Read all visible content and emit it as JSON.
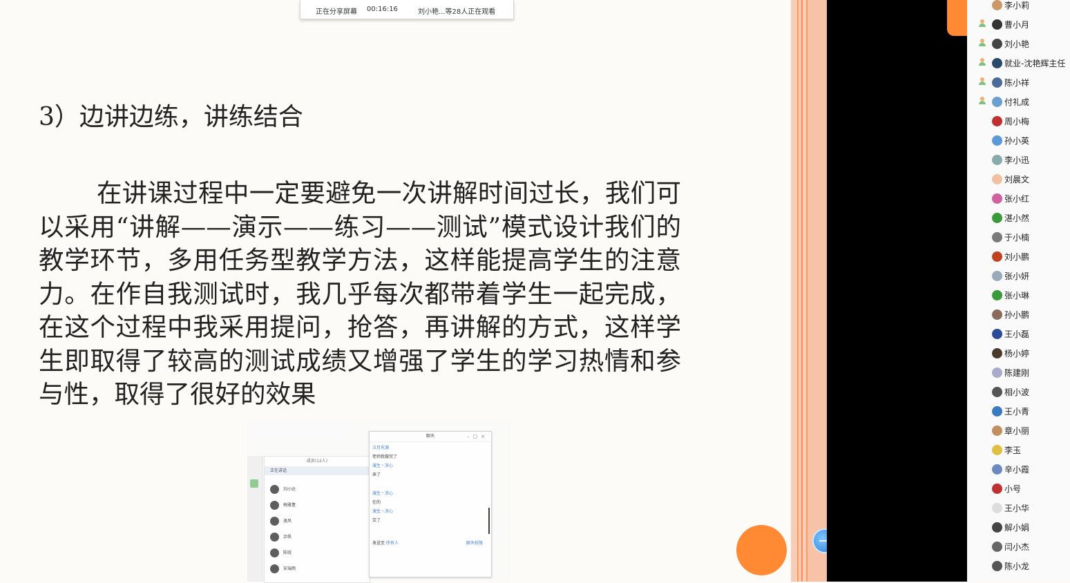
{
  "share_bar": {
    "status": "正在分享屏幕",
    "timer": "00:16:16",
    "viewers": "刘小艳...等28人正在观看"
  },
  "slide": {
    "heading": "3）边讲边练，讲练结合",
    "body": "在讲课过程中一定要避免一次讲解时间过长，我们可以采用“讲解——演示——练习——测试”模式设计我们的教学环节，多用任务型教学方法，这样能提高学生的注意力。在作自我测试时，我几乎每次都带着学生一起完成，在这个过程中我采用提问，抢答，再讲解的方式，这样学生即取得了较高的测试成绩又增强了学生的学习热情和参与性，取得了很好的效果"
  },
  "embedded": {
    "member_header": "成员(12人)",
    "member_filter": "正在讲话",
    "members": [
      "刘小达",
      "梅雅董",
      "逸风",
      "余帆",
      "陈晓",
      "安瑞雨"
    ],
    "chat_title": "聊天",
    "chat_lines": [
      {
        "type": "name",
        "text": "汪月东源"
      },
      {
        "type": "msg",
        "text": "老师我做完了"
      },
      {
        "type": "name",
        "text": "演生丶凉心"
      },
      {
        "type": "msg",
        "text": "来了"
      },
      {
        "type": "name",
        "text": "演生丶凉心"
      },
      {
        "type": "msg",
        "text": "在的"
      },
      {
        "type": "name",
        "text": "演生丶凉心"
      },
      {
        "type": "msg",
        "text": "交了"
      }
    ],
    "send_to_label": "发送至",
    "send_to_value": "所有人",
    "chat_permission": "聊天权限"
  },
  "attendees": [
    {
      "name": "李小莉",
      "host": false,
      "color": "#c96"
    },
    {
      "name": "曹小月",
      "host": true,
      "color": "#333"
    },
    {
      "name": "刘小艳",
      "host": true,
      "color": "#444"
    },
    {
      "name": "就业-沈艳辉主任",
      "host": true,
      "color": "#2a4a6a"
    },
    {
      "name": "陈小祥",
      "host": true,
      "color": "#4a6a9a"
    },
    {
      "name": "付礼成",
      "host": true,
      "color": "#6aa0d0"
    },
    {
      "name": "周小梅",
      "host": false,
      "color": "#c03030"
    },
    {
      "name": "孙小英",
      "host": false,
      "color": "#5a9ad8"
    },
    {
      "name": "李小迅",
      "host": false,
      "color": "#8aa"
    },
    {
      "name": "刘晨文",
      "host": false,
      "color": "#f0c0a0"
    },
    {
      "name": "张小红",
      "host": false,
      "color": "#d060a0"
    },
    {
      "name": "湛小然",
      "host": false,
      "color": "#3a9a3a"
    },
    {
      "name": "于小楠",
      "host": false,
      "color": "#7a7a7a"
    },
    {
      "name": "刘小鹏",
      "host": false,
      "color": "#c04020"
    },
    {
      "name": "张小妍",
      "host": false,
      "color": "#9ab"
    },
    {
      "name": "张小琳",
      "host": false,
      "color": "#3a9a3a"
    },
    {
      "name": "孙小鹏",
      "host": false,
      "color": "#8a6a5a"
    },
    {
      "name": "王小磊",
      "host": false,
      "color": "#2a4a9a"
    },
    {
      "name": "杨小婷",
      "host": false,
      "color": "#4a3a2a"
    },
    {
      "name": "陈建刚",
      "host": false,
      "color": "#aac"
    },
    {
      "name": "相小波",
      "host": false,
      "color": "#555"
    },
    {
      "name": "王小青",
      "host": false,
      "color": "#3a7ac0"
    },
    {
      "name": "章小丽",
      "host": false,
      "color": "#c09060"
    },
    {
      "name": "李玉",
      "host": false,
      "color": "#e0c040"
    },
    {
      "name": "辛小霞",
      "host": false,
      "color": "#6a8ac0"
    },
    {
      "name": "小号",
      "host": false,
      "color": "#c03030"
    },
    {
      "name": "王小华",
      "host": false,
      "color": "#ddd"
    },
    {
      "name": "解小娟",
      "host": false,
      "color": "#444"
    },
    {
      "name": "闫小杰",
      "host": false,
      "color": "#666"
    },
    {
      "name": "陈小龙",
      "host": false,
      "color": "#555"
    }
  ],
  "colors": {
    "accent_orange": "#ff8a33",
    "blue_button": "#2f7fd6",
    "video_bg": "#000000"
  }
}
